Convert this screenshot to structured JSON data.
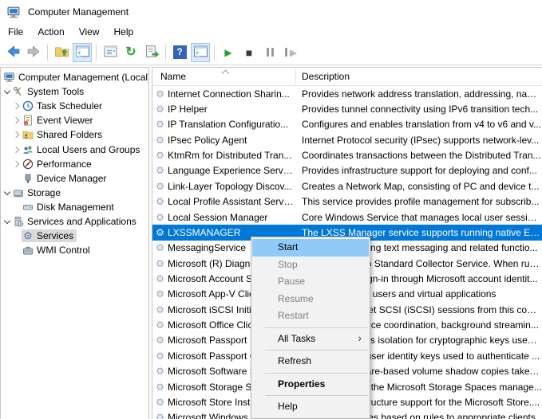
{
  "window": {
    "title": "Computer Management"
  },
  "menubar": {
    "items": [
      "File",
      "Action",
      "View",
      "Help"
    ]
  },
  "toolbar": {
    "icons": [
      "back",
      "forward",
      "up-one-level",
      "show-console-tree",
      "properties",
      "refresh",
      "export-list",
      "help",
      "show-action-pane",
      "start-service",
      "stop-service",
      "pause-service",
      "restart-service"
    ],
    "toggled": [
      "show-console-tree",
      "show-action-pane"
    ]
  },
  "tree": {
    "items": [
      {
        "label": "Computer Management (Local)",
        "icon": "computer",
        "level": 0,
        "chevron": "none"
      },
      {
        "label": "System Tools",
        "icon": "tools",
        "level": 1,
        "chevron": "expanded"
      },
      {
        "label": "Task Scheduler",
        "icon": "clock",
        "level": 2,
        "chevron": "collapsed"
      },
      {
        "label": "Event Viewer",
        "icon": "event",
        "level": 2,
        "chevron": "collapsed"
      },
      {
        "label": "Shared Folders",
        "icon": "folder-shared",
        "level": 2,
        "chevron": "collapsed"
      },
      {
        "label": "Local Users and Groups",
        "icon": "users",
        "level": 2,
        "chevron": "collapsed"
      },
      {
        "label": "Performance",
        "icon": "performance",
        "level": 2,
        "chevron": "collapsed"
      },
      {
        "label": "Device Manager",
        "icon": "device",
        "level": 2,
        "chevron": "none"
      },
      {
        "label": "Storage",
        "icon": "storage",
        "level": 1,
        "chevron": "expanded"
      },
      {
        "label": "Disk Management",
        "icon": "disk",
        "level": 2,
        "chevron": "none"
      },
      {
        "label": "Services and Applications",
        "icon": "server",
        "level": 1,
        "chevron": "expanded"
      },
      {
        "label": "Services",
        "icon": "gear",
        "level": 2,
        "chevron": "none",
        "selected": true
      },
      {
        "label": "WMI Control",
        "icon": "wmi",
        "level": 2,
        "chevron": "none"
      }
    ]
  },
  "list": {
    "columns": [
      "Name",
      "Description"
    ],
    "sort_column": "Name",
    "sort_direction": "ascending",
    "rows": [
      {
        "name": "Internet Connection Sharin...",
        "desc": "Provides network address translation, addressing, nam..."
      },
      {
        "name": "IP Helper",
        "desc": "Provides tunnel connectivity using IPv6 transition tech..."
      },
      {
        "name": "IP Translation Configuratio...",
        "desc": "Configures and enables translation from v4 to v6 and v..."
      },
      {
        "name": "IPsec Policy Agent",
        "desc": "Internet Protocol security (IPsec) supports network-lev..."
      },
      {
        "name": "KtmRm for Distributed Tran...",
        "desc": "Coordinates transactions between the Distributed Tran..."
      },
      {
        "name": "Language Experience Service",
        "desc": "Provides infrastructure support for deploying and conf..."
      },
      {
        "name": "Link-Layer Topology Discov...",
        "desc": "Creates a Network Map, consisting of PC and device t..."
      },
      {
        "name": "Local Profile Assistant Service",
        "desc": "This service provides profile management for subscrib..."
      },
      {
        "name": "Local Session Manager",
        "desc": "Core Windows Service that manages local user session..."
      },
      {
        "name": "LXSSMANAGER",
        "desc": "The LXSS Manager service supports running native ELF...",
        "selected": true
      },
      {
        "name": "MessagingService",
        "desc": "Service supporting text messaging and related functio..."
      },
      {
        "name": "Microsoft (R) Diagnostics Hub Standard Collector Service",
        "desc": "Diagnostics Hub Standard Collector Service. When run..."
      },
      {
        "name": "Microsoft Account Sign-in Assistant",
        "desc": "Enables user sign-in through Microsoft account identit..."
      },
      {
        "name": "Microsoft App-V Client",
        "desc": "Manages App-V users and virtual applications"
      },
      {
        "name": "Microsoft iSCSI Initiator Service",
        "desc": "Manages Internet SCSI (iSCSI) sessions from this comp..."
      },
      {
        "name": "Microsoft Office Click-to-Run Service",
        "desc": "Manages resource coordination, background streamin..."
      },
      {
        "name": "Microsoft Passport",
        "desc": "Provides process isolation for cryptographic keys used ..."
      },
      {
        "name": "Microsoft Passport Container",
        "desc": "Manages local user identity keys used to authenticate ..."
      },
      {
        "name": "Microsoft Software Shadow Copy Provider",
        "desc": "Manages software-based volume shadow copies taken..."
      },
      {
        "name": "Microsoft Storage Spaces SMP",
        "desc": "Host service for the Microsoft Storage Spaces manage..."
      },
      {
        "name": "Microsoft Store Install Service",
        "desc": "Provides infrastructure support for the Microsoft Store...."
      },
      {
        "name": "Microsoft Windows SMS Router Service",
        "desc": "Routes messages based on rules to appropriate clients."
      }
    ]
  },
  "context_menu": {
    "target": "LXSSMANAGER",
    "submenu_arrow": "›",
    "items": [
      {
        "label": "Start",
        "highlighted": true
      },
      {
        "label": "Stop",
        "disabled": true
      },
      {
        "label": "Pause",
        "disabled": true
      },
      {
        "label": "Resume",
        "disabled": true
      },
      {
        "label": "Restart",
        "disabled": true
      },
      {
        "separator": true
      },
      {
        "label": "All Tasks",
        "submenu": true
      },
      {
        "separator": true
      },
      {
        "label": "Refresh"
      },
      {
        "separator": true
      },
      {
        "label": "Properties",
        "bold": true
      },
      {
        "separator": true
      },
      {
        "label": "Help"
      }
    ]
  },
  "colors": {
    "selection_blue": "#0078d7",
    "menu_highlight": "#91c9f7",
    "menu_bg": "#f2f2f2",
    "tree_selection": "#d9d9d9",
    "disabled_text": "#7f7f7f",
    "toolbar_toggle_bg": "#d9eafa",
    "toolbar_toggle_border": "#9dc7ec"
  }
}
